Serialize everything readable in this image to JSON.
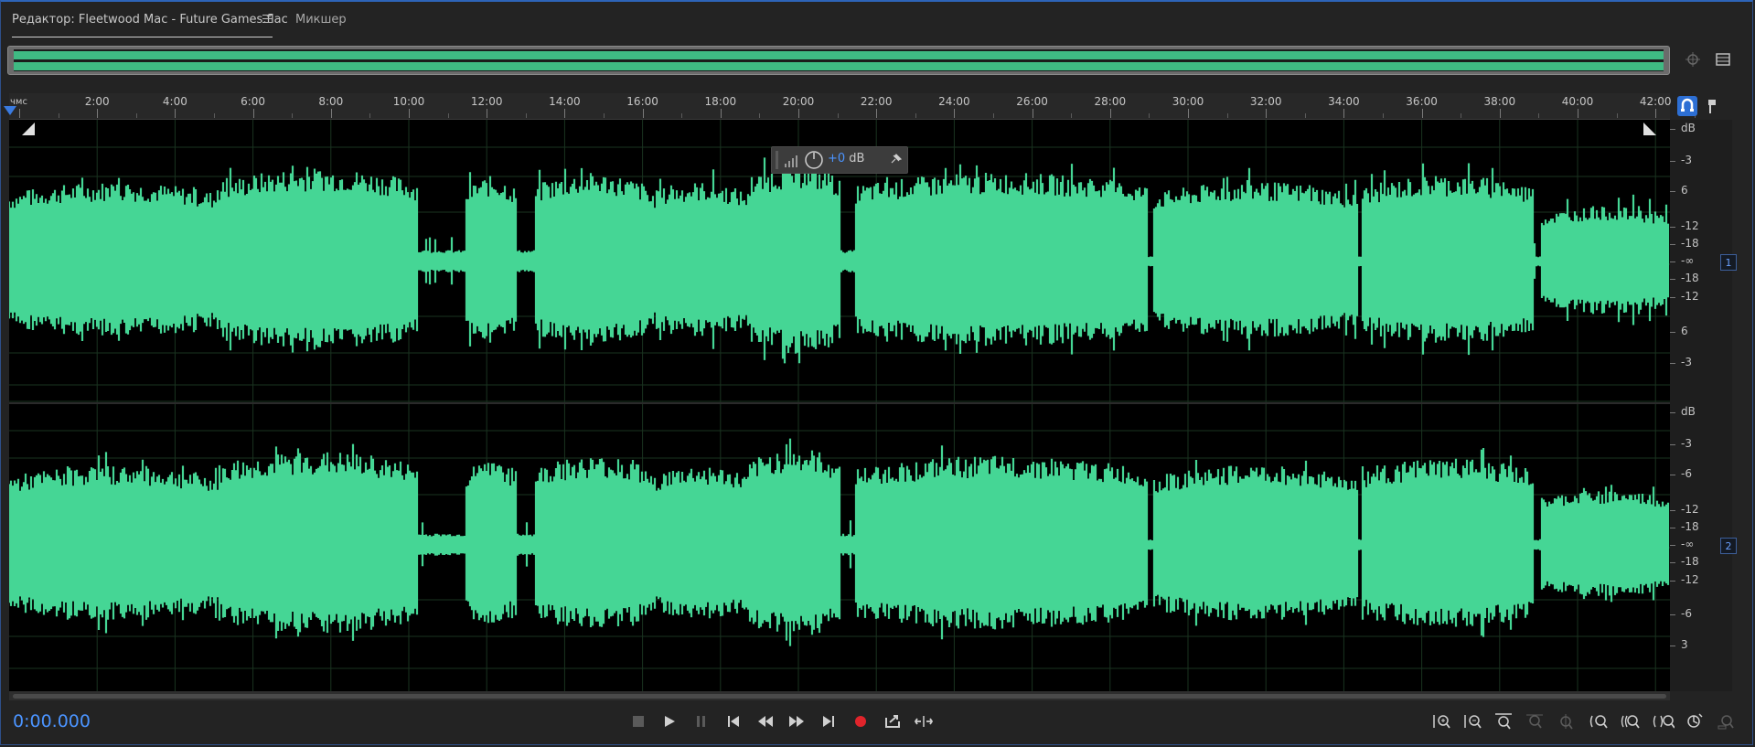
{
  "tabs": {
    "editor_label": "Редактор: Fleetwood Mac - Future Games.flac",
    "mixer_label": "Микшер"
  },
  "ruler": {
    "unit": "чмс",
    "labels": [
      "2:00",
      "4:00",
      "6:00",
      "8:00",
      "10:00",
      "12:00",
      "14:00",
      "16:00",
      "18:00",
      "20:00",
      "22:00",
      "24:00",
      "26:00",
      "28:00",
      "30:00",
      "32:00",
      "34:00",
      "36:00",
      "38:00",
      "40:00",
      "42:00"
    ]
  },
  "hud": {
    "gain_sign": "+0",
    "gain_unit": " dB"
  },
  "scale": {
    "unit": "dB",
    "ch1_labels": [
      "-3",
      "6",
      "-12",
      "-18",
      "-∞",
      "-18",
      "-12",
      "6",
      "-3"
    ],
    "ch2_labels": [
      "-3",
      "-6",
      "-12",
      "-18",
      "-∞",
      "-18",
      "-12",
      "-6",
      "3"
    ],
    "ch1_badge": "1",
    "ch2_badge": "2"
  },
  "status": {
    "time": "0:00.000"
  },
  "colors": {
    "waveform": "#45d695",
    "accent": "#4b94ff",
    "record": "#e0242b"
  },
  "icons": {
    "transport": [
      "stop-icon",
      "play-icon",
      "pause-icon",
      "go-to-start-icon",
      "rewind-icon",
      "fast-forward-icon",
      "go-to-end-icon",
      "record-icon",
      "loop-playback-icon",
      "skip-selection-icon"
    ],
    "zoom": [
      "zoom-in-amplitude-icon",
      "zoom-out-amplitude-icon",
      "zoom-reset-amplitude-icon",
      "zoom-in-time-icon",
      "zoom-out-time-icon",
      "zoom-out-full-icon",
      "zoom-to-selection-icon",
      "zoom-in-left-icon",
      "zoom-in-right-icon",
      "zoom-selection-icon",
      "zoom-tracks-icon"
    ]
  }
}
